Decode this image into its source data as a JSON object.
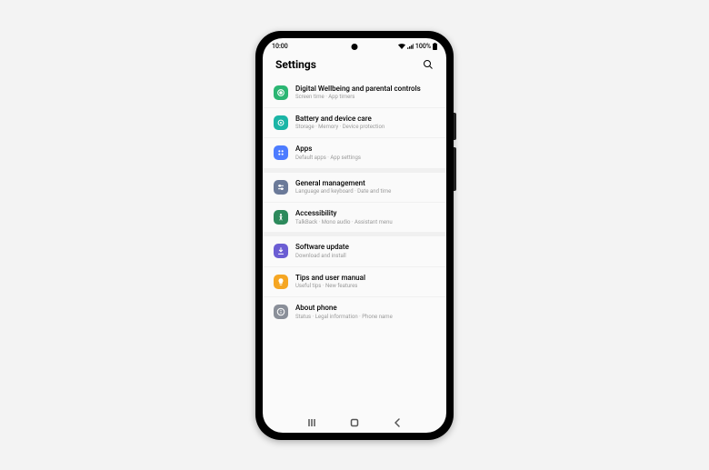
{
  "status": {
    "time": "10:00",
    "battery": "100%"
  },
  "header": {
    "title": "Settings"
  },
  "items": [
    {
      "title": "Digital Wellbeing and parental controls",
      "sub": "Screen time · App timers"
    },
    {
      "title": "Battery and device care",
      "sub": "Storage · Memory · Device protection"
    },
    {
      "title": "Apps",
      "sub": "Default apps · App settings"
    },
    {
      "title": "General management",
      "sub": "Language and keyboard · Date and time"
    },
    {
      "title": "Accessibility",
      "sub": "TalkBack · Mono audio · Assistant menu"
    },
    {
      "title": "Software update",
      "sub": "Download and install"
    },
    {
      "title": "Tips and user manual",
      "sub": "Useful tips · New features"
    },
    {
      "title": "About phone",
      "sub": "Status · Legal information · Phone name"
    }
  ],
  "colors": {
    "wellbeing": "#2bb673",
    "battery": "#1bb5a6",
    "apps": "#4d7cff",
    "general": "#6b7a99",
    "accessibility": "#2d8a5c",
    "software": "#6b5dd3",
    "tips": "#f5a623",
    "about": "#8a8f99"
  }
}
